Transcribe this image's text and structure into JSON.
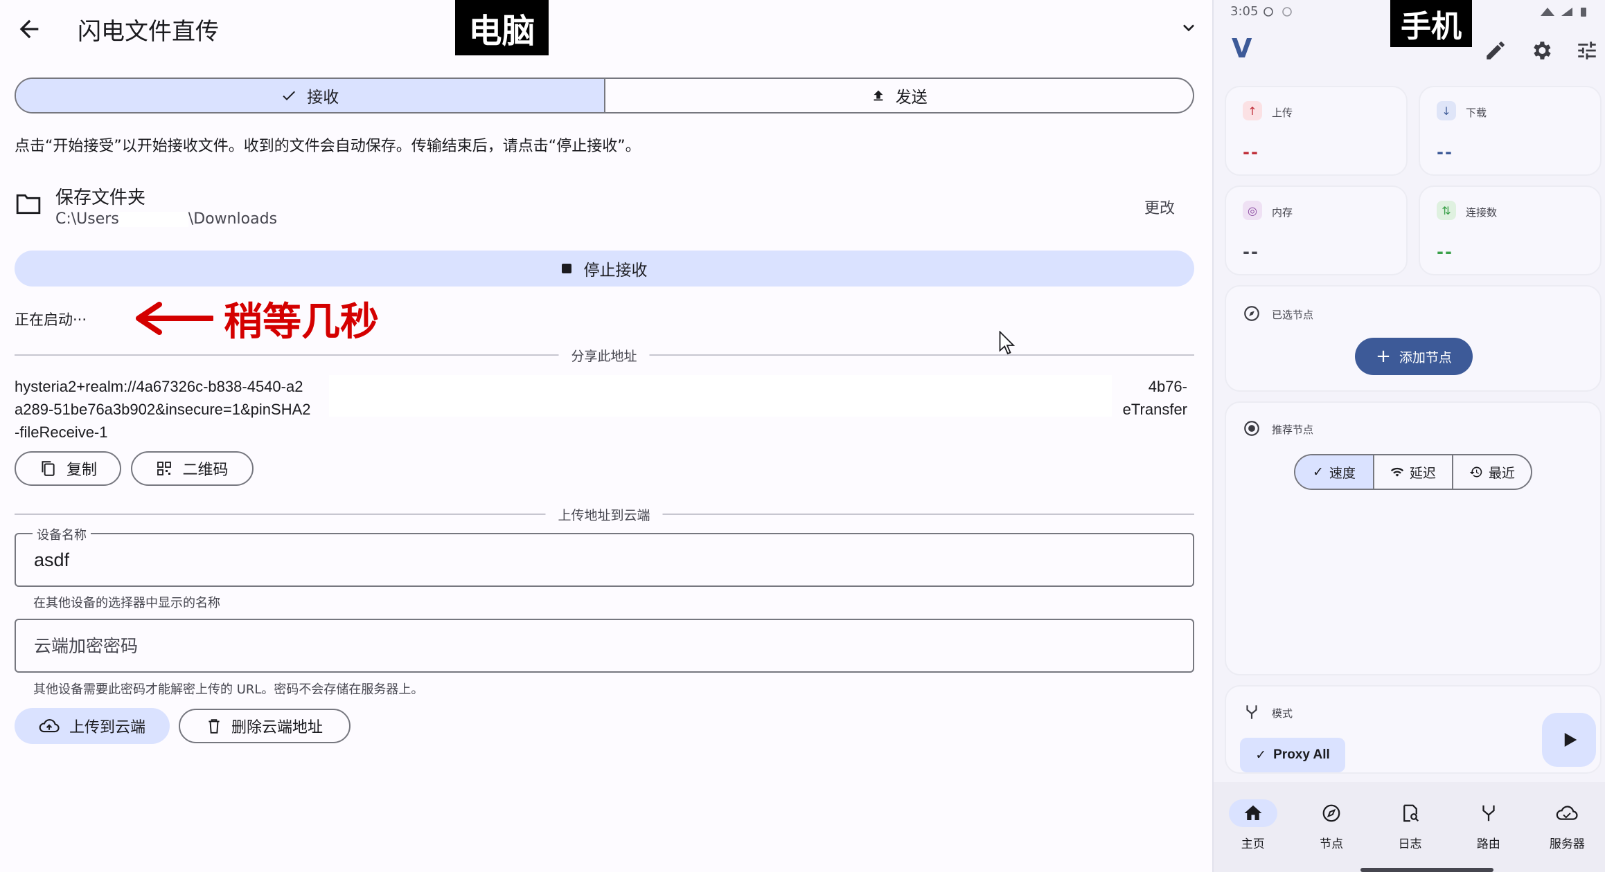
{
  "tags": {
    "pc": "电脑",
    "phone": "手机"
  },
  "desktop": {
    "title": "闪电文件直传",
    "tabs": [
      {
        "label": "接收",
        "active": true
      },
      {
        "label": "发送",
        "active": false
      }
    ],
    "description": "点击“开始接受”以开始接收文件。收到的文件会自动保存。传输结束后，请点击“停止接收”。",
    "folder": {
      "title": "保存文件夹",
      "path_prefix": "C:\\Users",
      "path_suffix": "\\Downloads",
      "change_label": "更改"
    },
    "stop_label": "停止接收",
    "status_text": "正在启动···",
    "annotation": "稍等几秒",
    "share_divider": "分享此地址",
    "address": {
      "line1_left": "hysteria2+realm://4a67326c-b838-4540-a2",
      "line1_right": "4b76-",
      "line2_left": "a289-51be76a3b902&insecure=1&pinSHA2",
      "line2_right": "eTransfer",
      "line3": "-fileReceive-1"
    },
    "copy_label": "复制",
    "qrcode_label": "二维码",
    "cloud_divider": "上传地址到云端",
    "device_name": {
      "label": "设备名称",
      "value": "asdf",
      "helper": "在其他设备的选择器中显示的名称"
    },
    "cloud_password": {
      "placeholder": "云端加密密码",
      "helper": "其他设备需要此密码才能解密上传的 URL。密码不会存储在服务器上。"
    },
    "upload_label": "上传到云端",
    "delete_label": "删除云端地址"
  },
  "phone": {
    "status_time": "3:05",
    "logo": "V",
    "cards": {
      "upload": {
        "title": "上传",
        "value": "--"
      },
      "download": {
        "title": "下载",
        "value": "--"
      },
      "memory": {
        "title": "内存",
        "value": "--"
      },
      "connections": {
        "title": "连接数",
        "value": "--"
      }
    },
    "selected_node": {
      "title": "已选节点",
      "add_label": "添加节点"
    },
    "recommended": {
      "title": "推荐节点",
      "options": [
        {
          "label": "速度",
          "active": true
        },
        {
          "label": "延迟",
          "active": false
        },
        {
          "label": "最近",
          "active": false
        }
      ]
    },
    "mode": {
      "title": "模式",
      "value": "Proxy All"
    },
    "nav": [
      {
        "label": "主页",
        "icon": "home-icon",
        "active": true
      },
      {
        "label": "节点",
        "icon": "compass-icon",
        "active": false
      },
      {
        "label": "日志",
        "icon": "log-icon",
        "active": false
      },
      {
        "label": "路由",
        "icon": "route-icon",
        "active": false
      },
      {
        "label": "服务器",
        "icon": "cloud-icon",
        "active": false
      }
    ],
    "colors": {
      "primary": "#3d5a98",
      "up_accent": "#c0303a",
      "down_accent": "#3d5a98",
      "conn_accent": "#3aa04a"
    }
  }
}
